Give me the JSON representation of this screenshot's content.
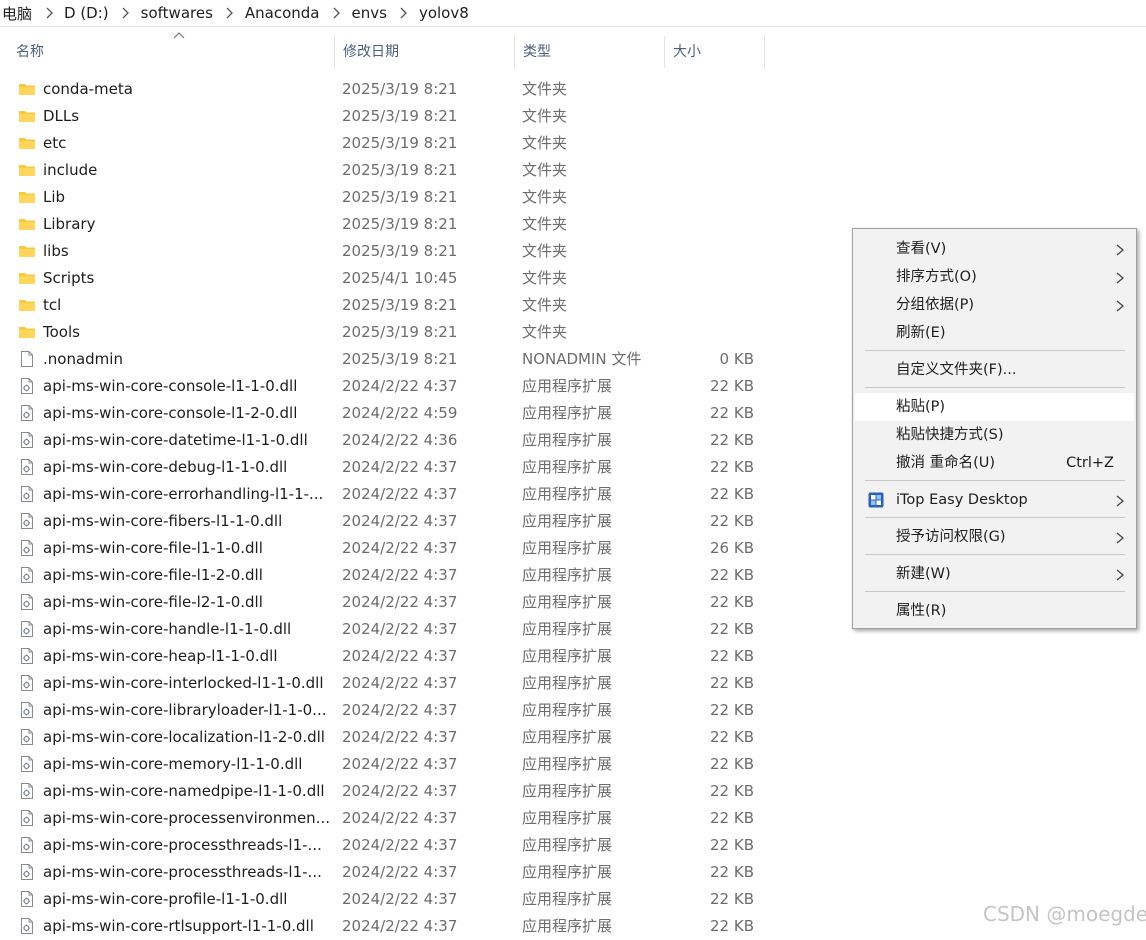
{
  "breadcrumb": [
    "电脑",
    "D (D:)",
    "softwares",
    "Anaconda",
    "envs",
    "yolov8"
  ],
  "columns": {
    "name": "名称",
    "modified": "修改日期",
    "type": "类型",
    "size": "大小"
  },
  "files": [
    {
      "name": "conda-meta",
      "date": "2025/3/19 8:21",
      "type": "文件夹",
      "size": "",
      "kind": "folder"
    },
    {
      "name": "DLLs",
      "date": "2025/3/19 8:21",
      "type": "文件夹",
      "size": "",
      "kind": "folder"
    },
    {
      "name": "etc",
      "date": "2025/3/19 8:21",
      "type": "文件夹",
      "size": "",
      "kind": "folder"
    },
    {
      "name": "include",
      "date": "2025/3/19 8:21",
      "type": "文件夹",
      "size": "",
      "kind": "folder"
    },
    {
      "name": "Lib",
      "date": "2025/3/19 8:21",
      "type": "文件夹",
      "size": "",
      "kind": "folder"
    },
    {
      "name": "Library",
      "date": "2025/3/19 8:21",
      "type": "文件夹",
      "size": "",
      "kind": "folder"
    },
    {
      "name": "libs",
      "date": "2025/3/19 8:21",
      "type": "文件夹",
      "size": "",
      "kind": "folder"
    },
    {
      "name": "Scripts",
      "date": "2025/4/1 10:45",
      "type": "文件夹",
      "size": "",
      "kind": "folder"
    },
    {
      "name": "tcl",
      "date": "2025/3/19 8:21",
      "type": "文件夹",
      "size": "",
      "kind": "folder"
    },
    {
      "name": "Tools",
      "date": "2025/3/19 8:21",
      "type": "文件夹",
      "size": "",
      "kind": "folder"
    },
    {
      "name": ".nonadmin",
      "date": "2025/3/19 8:21",
      "type": "NONADMIN 文件",
      "size": "0 KB",
      "kind": "file"
    },
    {
      "name": "api-ms-win-core-console-l1-1-0.dll",
      "date": "2024/2/22 4:37",
      "type": "应用程序扩展",
      "size": "22 KB",
      "kind": "dll"
    },
    {
      "name": "api-ms-win-core-console-l1-2-0.dll",
      "date": "2024/2/22 4:59",
      "type": "应用程序扩展",
      "size": "22 KB",
      "kind": "dll"
    },
    {
      "name": "api-ms-win-core-datetime-l1-1-0.dll",
      "date": "2024/2/22 4:36",
      "type": "应用程序扩展",
      "size": "22 KB",
      "kind": "dll"
    },
    {
      "name": "api-ms-win-core-debug-l1-1-0.dll",
      "date": "2024/2/22 4:37",
      "type": "应用程序扩展",
      "size": "22 KB",
      "kind": "dll"
    },
    {
      "name": "api-ms-win-core-errorhandling-l1-1-...",
      "date": "2024/2/22 4:37",
      "type": "应用程序扩展",
      "size": "22 KB",
      "kind": "dll"
    },
    {
      "name": "api-ms-win-core-fibers-l1-1-0.dll",
      "date": "2024/2/22 4:37",
      "type": "应用程序扩展",
      "size": "22 KB",
      "kind": "dll"
    },
    {
      "name": "api-ms-win-core-file-l1-1-0.dll",
      "date": "2024/2/22 4:37",
      "type": "应用程序扩展",
      "size": "26 KB",
      "kind": "dll"
    },
    {
      "name": "api-ms-win-core-file-l1-2-0.dll",
      "date": "2024/2/22 4:37",
      "type": "应用程序扩展",
      "size": "22 KB",
      "kind": "dll"
    },
    {
      "name": "api-ms-win-core-file-l2-1-0.dll",
      "date": "2024/2/22 4:37",
      "type": "应用程序扩展",
      "size": "22 KB",
      "kind": "dll"
    },
    {
      "name": "api-ms-win-core-handle-l1-1-0.dll",
      "date": "2024/2/22 4:37",
      "type": "应用程序扩展",
      "size": "22 KB",
      "kind": "dll"
    },
    {
      "name": "api-ms-win-core-heap-l1-1-0.dll",
      "date": "2024/2/22 4:37",
      "type": "应用程序扩展",
      "size": "22 KB",
      "kind": "dll"
    },
    {
      "name": "api-ms-win-core-interlocked-l1-1-0.dll",
      "date": "2024/2/22 4:37",
      "type": "应用程序扩展",
      "size": "22 KB",
      "kind": "dll"
    },
    {
      "name": "api-ms-win-core-libraryloader-l1-1-0...",
      "date": "2024/2/22 4:37",
      "type": "应用程序扩展",
      "size": "22 KB",
      "kind": "dll"
    },
    {
      "name": "api-ms-win-core-localization-l1-2-0.dll",
      "date": "2024/2/22 4:37",
      "type": "应用程序扩展",
      "size": "22 KB",
      "kind": "dll"
    },
    {
      "name": "api-ms-win-core-memory-l1-1-0.dll",
      "date": "2024/2/22 4:37",
      "type": "应用程序扩展",
      "size": "22 KB",
      "kind": "dll"
    },
    {
      "name": "api-ms-win-core-namedpipe-l1-1-0.dll",
      "date": "2024/2/22 4:37",
      "type": "应用程序扩展",
      "size": "22 KB",
      "kind": "dll"
    },
    {
      "name": "api-ms-win-core-processenvironmen...",
      "date": "2024/2/22 4:37",
      "type": "应用程序扩展",
      "size": "22 KB",
      "kind": "dll"
    },
    {
      "name": "api-ms-win-core-processthreads-l1-...",
      "date": "2024/2/22 4:37",
      "type": "应用程序扩展",
      "size": "22 KB",
      "kind": "dll"
    },
    {
      "name": "api-ms-win-core-processthreads-l1-...",
      "date": "2024/2/22 4:37",
      "type": "应用程序扩展",
      "size": "22 KB",
      "kind": "dll"
    },
    {
      "name": "api-ms-win-core-profile-l1-1-0.dll",
      "date": "2024/2/22 4:37",
      "type": "应用程序扩展",
      "size": "22 KB",
      "kind": "dll"
    },
    {
      "name": "api-ms-win-core-rtlsupport-l1-1-0.dll",
      "date": "2024/2/22 4:37",
      "type": "应用程序扩展",
      "size": "22 KB",
      "kind": "dll"
    }
  ],
  "context_menu": {
    "view": "查看(V)",
    "sort_by": "排序方式(O)",
    "group_by": "分组依据(P)",
    "refresh": "刷新(E)",
    "customize_folder": "自定义文件夹(F)...",
    "paste": "粘贴(P)",
    "paste_shortcut": "粘贴快捷方式(S)",
    "undo_rename": "撤消 重命名(U)",
    "undo_shortcut": "Ctrl+Z",
    "itop": "iTop Easy Desktop",
    "give_access": "授予访问权限(G)",
    "new": "新建(W)",
    "properties": "属性(R)"
  },
  "watermark": "CSDN @moegde",
  "colors": {
    "folder": "#f8c93a",
    "header_text": "#4c607a",
    "menu_bg": "#f2f2f2",
    "hover_bg": "#ffffff"
  },
  "icons": {
    "folder": "folder-icon",
    "file": "file-icon",
    "dll": "dll-file-icon",
    "submenu": "chevron-right-icon",
    "sort": "sort-up-arrow-icon",
    "itop": "itop-app-icon"
  }
}
